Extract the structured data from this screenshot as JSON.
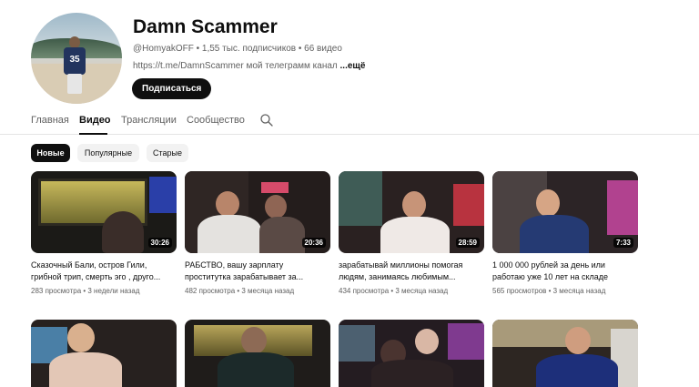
{
  "channel": {
    "name": "Damn Scammer",
    "meta": "@HomyakOFF • 1,55 тыс. подписчиков • 66 видео",
    "description": "https://t.me/DamnScammer мой телеграмм канал ",
    "description_more": "...ещё",
    "subscribe_label": "Подписаться",
    "avatar_jersey_number": "35"
  },
  "tabs": [
    {
      "label": "Главная",
      "active": false
    },
    {
      "label": "Видео",
      "active": true
    },
    {
      "label": "Трансляции",
      "active": false
    },
    {
      "label": "Сообщество",
      "active": false
    }
  ],
  "search_icon": "search-icon",
  "chips": [
    {
      "label": "Новые",
      "active": true
    },
    {
      "label": "Популярные",
      "active": false
    },
    {
      "label": "Старые",
      "active": false
    }
  ],
  "videos": [
    {
      "title": "Сказочный Бали, остров Гили, грибной трип, смерть эго , друго...",
      "duration": "30:26",
      "stats": "283 просмотра • 3 недели назад"
    },
    {
      "title": "РАБСТВО, вашу зарплату проститутка зарабатывает за...",
      "duration": "20:36",
      "stats": "482 просмотра • 3 месяца назад"
    },
    {
      "title": "зарабатывай миллионы помогая людям, занимаясь любимым...",
      "duration": "28:59",
      "stats": "434 просмотра • 3 месяца назад"
    },
    {
      "title": "1 000 000 рублей за день или работаю уже 10 лет на складе",
      "duration": "7:33",
      "stats": "565 просмотров • 3 месяца назад"
    },
    {
      "title": "",
      "duration": "",
      "stats": ""
    },
    {
      "title": "",
      "duration": "",
      "stats": ""
    },
    {
      "title": "",
      "duration": "",
      "stats": ""
    },
    {
      "title": "",
      "duration": "",
      "stats": ""
    }
  ],
  "colors": {
    "accent": "#0f0f0f",
    "secondary_text": "#606060",
    "chip_bg": "#f2f2f2"
  }
}
